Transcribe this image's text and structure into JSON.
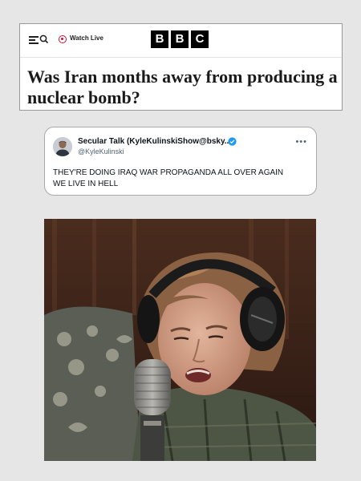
{
  "bbc": {
    "watch_live_label": "Watch Live",
    "logo_letters": [
      "B",
      "B",
      "C"
    ],
    "headline": "Was Iran months away from producing a nuclear bomb?"
  },
  "tweet": {
    "display_name": "Secular Talk (KyleKulinskiShow@bsky...",
    "handle": "@KyleKulinski",
    "text_line1": "THEY'RE DOING IRAQ WAR PROPAGANDA ALL OVER AGAIN",
    "text_line2": "WE LIVE IN HELL",
    "verified_color": "#1d9bf0"
  },
  "colors": {
    "page_background": "#e6e6e6",
    "live_red": "#c8102e",
    "bbc_black": "#000000"
  }
}
